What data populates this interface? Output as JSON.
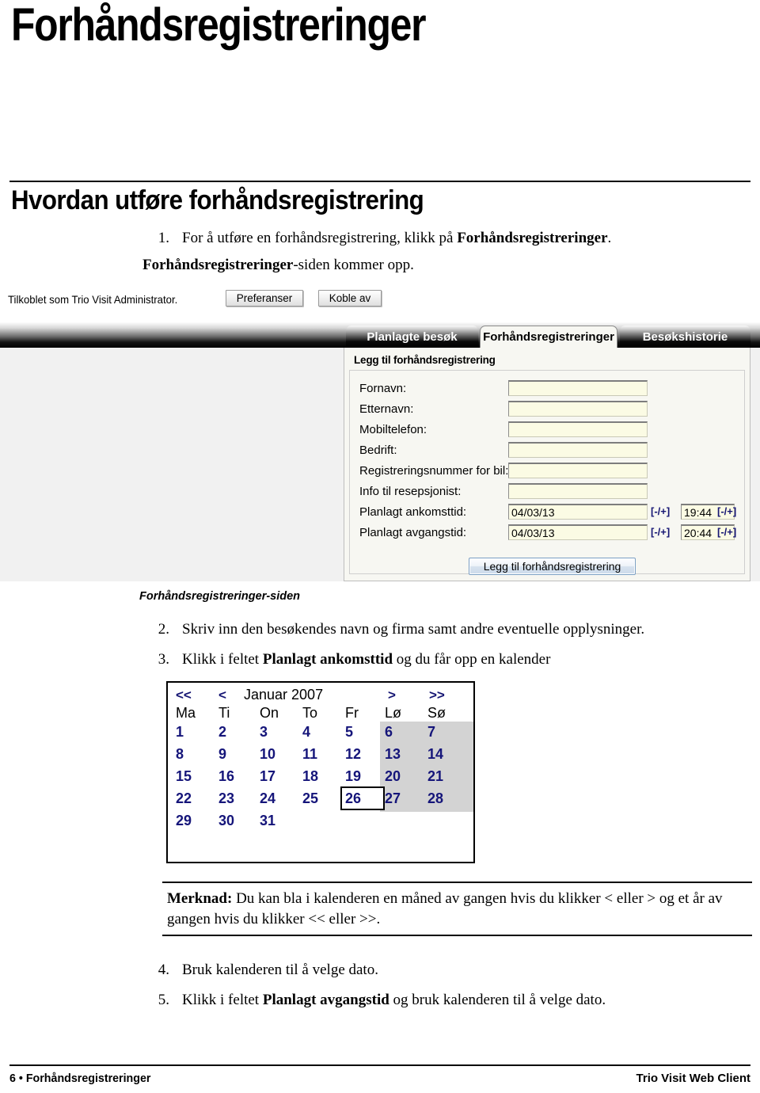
{
  "document": {
    "title": "Forhåndsregistreringer",
    "section_heading": "Hvordan utføre forhåndsregistrering"
  },
  "steps": [
    {
      "number": "1.",
      "text_before": "For å utføre en forhåndsregistrering, klikk på ",
      "bold": "Forhåndsregistreringer",
      "text_after": "."
    },
    {
      "number": "2.",
      "text_before": "Skriv inn den besøkendes navn og firma samt andre eventuelle opplysninger.",
      "bold": "",
      "text_after": ""
    },
    {
      "number": "3.",
      "text_before": "Klikk i feltet ",
      "bold": "Planlagt ankomsttid",
      "text_after": "  og du får opp en kalender"
    },
    {
      "number": "4.",
      "text_before": "Bruk kalenderen til å velge dato.",
      "bold": "",
      "text_after": ""
    },
    {
      "number": "5.",
      "text_before": "Klikk i feltet ",
      "bold": "Planlagt avgangstid",
      "text_after": "  og bruk kalenderen til å velge dato."
    }
  ],
  "step1_followup": {
    "bold": "Forhåndsregistreringer",
    "rest": "-siden kommer opp."
  },
  "screenshot": {
    "connection_status": "Tilkoblet som Trio Visit Administrator.",
    "preferences_button": "Preferanser",
    "logout_button": "Koble av",
    "tabs": [
      {
        "label": "Planlagte besøk",
        "active": false
      },
      {
        "label": "Forhåndsregistreringer",
        "active": true
      },
      {
        "label": "Besøkshistorie",
        "active": false
      }
    ],
    "panel_title": "Legg til forhåndsregistrering",
    "fields": [
      {
        "label": "Fornavn:",
        "value": ""
      },
      {
        "label": "Etternavn:",
        "value": ""
      },
      {
        "label": "Mobiltelefon:",
        "value": ""
      },
      {
        "label": "Bedrift:",
        "value": ""
      },
      {
        "label": "Registreringsnummer for bil:",
        "value": ""
      },
      {
        "label": "Info til resepsjonist:",
        "value": ""
      }
    ],
    "datetime_rows": [
      {
        "label": "Planlagt ankomsttid:",
        "date_value": "04/03/13",
        "date_spinner": "[-/+]",
        "time_value": "19:44",
        "time_spinner": "[-/+]"
      },
      {
        "label": "Planlagt avgangstid:",
        "date_value": "04/03/13",
        "date_spinner": "[-/+]",
        "time_value": "20:44",
        "time_spinner": "[-/+]"
      }
    ],
    "submit_button": "Legg til forhåndsregistrering",
    "caption": "Forhåndsregistreringer-siden"
  },
  "calendar": {
    "nav_prev_year": "<<",
    "nav_prev_month": "<",
    "month_year": "Januar 2007",
    "nav_next_month": ">",
    "nav_next_year": ">>",
    "day_names": [
      "Ma",
      "Ti",
      "On",
      "To",
      "Fr",
      "Lø",
      "Sø"
    ],
    "weeks": [
      [
        "1",
        "2",
        "3",
        "4",
        "5",
        "6",
        "7"
      ],
      [
        "8",
        "9",
        "10",
        "11",
        "12",
        "13",
        "14"
      ],
      [
        "15",
        "16",
        "17",
        "18",
        "19",
        "20",
        "21"
      ],
      [
        "22",
        "23",
        "24",
        "25",
        "26",
        "27",
        "28"
      ],
      [
        "29",
        "30",
        "31",
        "",
        "",
        "",
        ""
      ]
    ],
    "selected_day": "26",
    "weekend_columns": [
      5,
      6
    ],
    "colors": {
      "day_text": "#15157a",
      "nav_text": "#151573",
      "weekend_bg": "#d3d3d3"
    }
  },
  "note": {
    "label": "Merknad:",
    "text": " Du kan bla i kalenderen en måned av gangen hvis du klikker < eller > og et år av gangen hvis du klikker << eller >>."
  },
  "footer": {
    "page_number": "6",
    "separator": "•",
    "left_text": "Forhåndsregistreringer",
    "right_text": "Trio Visit Web Client"
  }
}
